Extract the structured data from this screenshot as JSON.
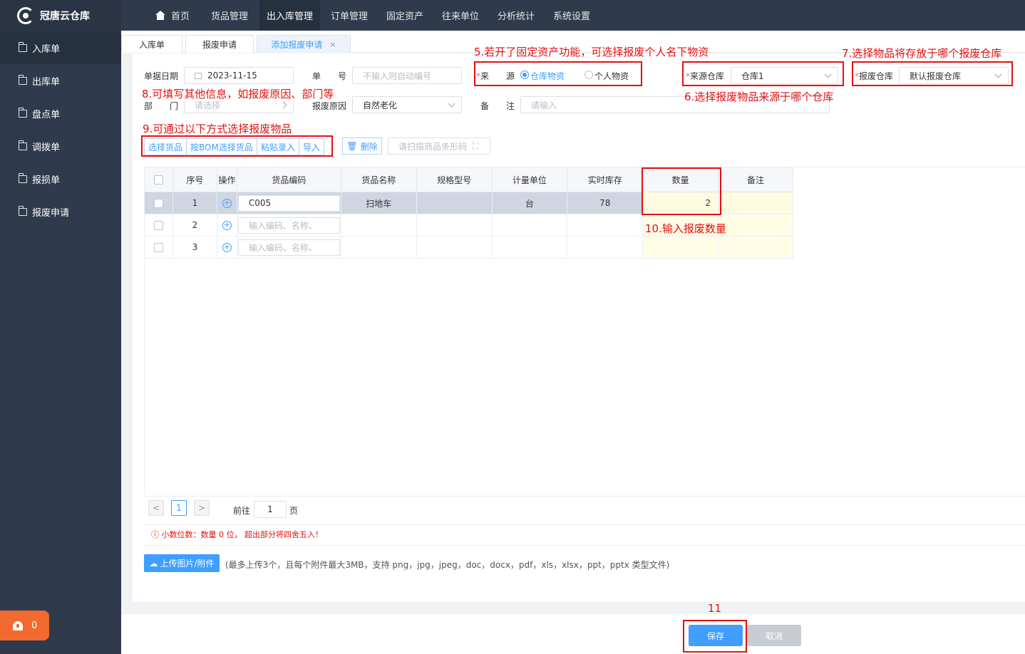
{
  "app": {
    "title": "冠唐云仓库"
  },
  "sidebar": {
    "items": [
      {
        "label": "入库单"
      },
      {
        "label": "出库单"
      },
      {
        "label": "盘点单"
      },
      {
        "label": "调拨单"
      },
      {
        "label": "报损单"
      },
      {
        "label": "报废申请"
      }
    ],
    "notification_count": "0"
  },
  "topnav": {
    "items": [
      {
        "label": "首页"
      },
      {
        "label": "货品管理"
      },
      {
        "label": "出入库管理"
      },
      {
        "label": "订单管理"
      },
      {
        "label": "固定资产"
      },
      {
        "label": "往来单位"
      },
      {
        "label": "分析统计"
      },
      {
        "label": "系统设置"
      }
    ]
  },
  "tabs": [
    {
      "label": "入库单"
    },
    {
      "label": "报废申请"
    },
    {
      "label": "添加报废申请",
      "close": "×"
    }
  ],
  "form": {
    "doc_date_label": "单据日期",
    "doc_date_value": "2023-11-15",
    "doc_no_label": "单　　号",
    "doc_no_placeholder": "不输入则自动编号",
    "source_label": "来　　源",
    "source_option1": "仓库物资",
    "source_option2": "个人物资",
    "source_wh_label": "来源仓库",
    "source_wh_value": "仓库1",
    "scrap_wh_label": "报废仓库",
    "scrap_wh_value": "默认报废仓库",
    "dept_label": "部　　门",
    "dept_placeholder": "请选择",
    "reason_label": "报废原因",
    "reason_value": "自然老化",
    "remark_label": "备　　注",
    "remark_placeholder": "请输入"
  },
  "toolbar": {
    "select_goods": "选择货品",
    "select_bom": "按BOM选择货品",
    "paste_entry": "粘贴录入",
    "import": "导入",
    "delete": "删除",
    "scan_placeholder": "请扫描商品条形码"
  },
  "table": {
    "headers": [
      "序号",
      "操作",
      "货品编码",
      "货品名称",
      "规格型号",
      "计量单位",
      "实时库存",
      "数量",
      "备注"
    ],
    "code_placeholder": "输入编码、名称、",
    "rows": [
      {
        "no": "1",
        "code": "C005",
        "name": "扫地车",
        "spec": "",
        "unit": "台",
        "stock": "78",
        "qty": "2",
        "remark": ""
      },
      {
        "no": "2",
        "code": "",
        "name": "",
        "spec": "",
        "unit": "",
        "stock": "",
        "qty": "",
        "remark": ""
      },
      {
        "no": "3",
        "code": "",
        "name": "",
        "spec": "",
        "unit": "",
        "stock": "",
        "qty": "",
        "remark": ""
      }
    ]
  },
  "pager": {
    "prev": "<",
    "page": "1",
    "next": ">",
    "goto_label": "前往",
    "goto_value": "1",
    "page_suffix": "页"
  },
  "decimal_note": "ⓘ 小数位数：数量 0 位， 超出部分将四舍五入！",
  "upload": {
    "button": "上传图片/附件",
    "note": "(最多上传3个，且每个附件最大3MB，支持 png，jpg，jpeg，doc，docx，pdf，xls，xlsx，ppt，pptx 类型文件)"
  },
  "footer": {
    "save": "保存",
    "cancel": "取消"
  },
  "annotations": {
    "a5": "5.若开了固定资产功能，可选择报废个人名下物资",
    "a6": "6.选择报废物品来源于哪个仓库",
    "a7": "7.选择物品将存放于哪个报废仓库",
    "a8": "8.可填写其他信息，如报废原因、部门等",
    "a9": "9.可通过以下方式选择报废物品",
    "a10": "10.输入报废数量",
    "a11": "11"
  },
  "colors": {
    "accent": "#409eff",
    "sidebar": "#2f3b4c",
    "annotation": "#e3110f",
    "notify": "#f26a2f"
  }
}
